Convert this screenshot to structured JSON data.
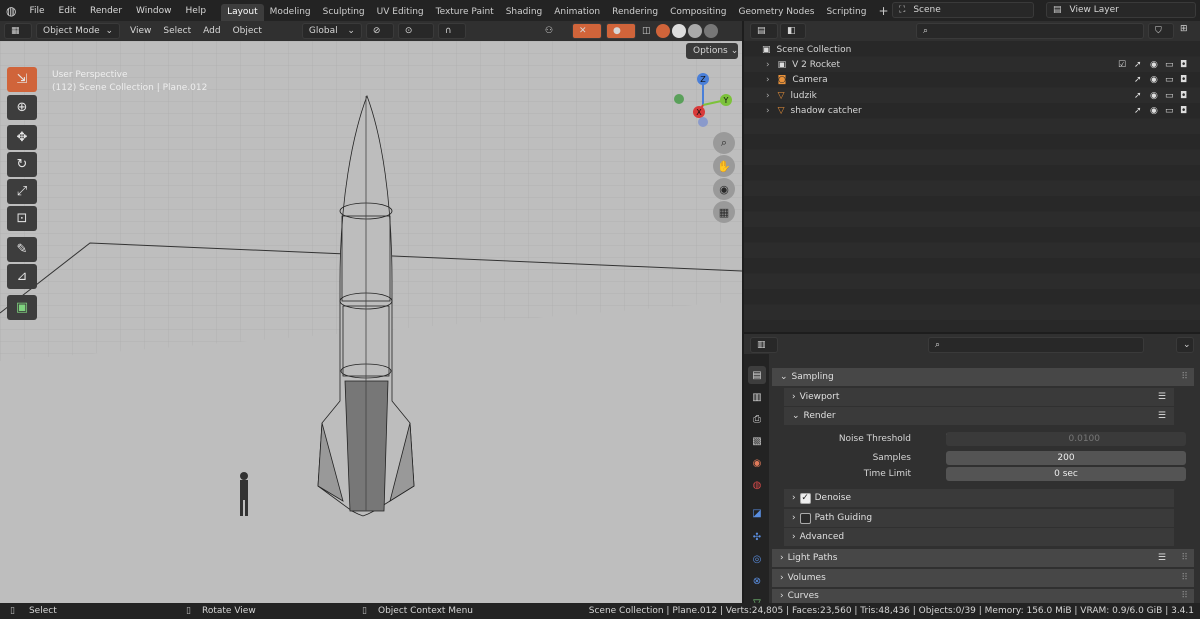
{
  "menu": [
    "File",
    "Edit",
    "Render",
    "Window",
    "Help"
  ],
  "workspaces": [
    "Layout",
    "Modeling",
    "Sculpting",
    "UV Editing",
    "Texture Paint",
    "Shading",
    "Animation",
    "Rendering",
    "Compositing",
    "Geometry Nodes",
    "Scripting"
  ],
  "active_workspace": "Layout",
  "add_tab": "+",
  "scene": "Scene",
  "view_layer": "View Layer",
  "viewport": {
    "mode": "Object Mode",
    "menus": [
      "View",
      "Select",
      "Add",
      "Object"
    ],
    "orientation": "Global",
    "options": "Options",
    "overlay_title": "User Perspective",
    "overlay_sub": "(112) Scene Collection | Plane.012",
    "gizmo": {
      "z": "Z",
      "y": "Y",
      "x": "X"
    }
  },
  "outliner": {
    "root": "Scene Collection",
    "items": [
      {
        "name": "V 2 Rocket",
        "icon": "collection-icon"
      },
      {
        "name": "Camera",
        "icon": "camera-icon"
      },
      {
        "name": "ludzik",
        "icon": "mesh-icon"
      },
      {
        "name": "shadow catcher",
        "icon": "mesh-icon"
      }
    ]
  },
  "properties": {
    "sampling": "Sampling",
    "viewport": "Viewport",
    "render": "Render",
    "noise_threshold_label": "Noise Threshold",
    "noise_threshold_value": "0.0100",
    "samples_label": "Samples",
    "samples_value": "200",
    "time_limit_label": "Time Limit",
    "time_limit_value": "0 sec",
    "denoise": "Denoise",
    "path_guiding": "Path Guiding",
    "advanced": "Advanced",
    "light_paths": "Light Paths",
    "volumes": "Volumes",
    "curves": "Curves"
  },
  "status": {
    "select": "Select",
    "rotate": "Rotate View",
    "context": "Object Context Menu",
    "stats": "Scene Collection | Plane.012 | Verts:24,805 | Faces:23,560 | Tris:48,436 | Objects:0/39 | Memory: 156.0 MiB | VRAM: 0.9/6.0 GiB | 3.4.1"
  },
  "colors": {
    "accent": "#d0643a",
    "header": "#303030",
    "viewport_bg": "#bebebe"
  }
}
